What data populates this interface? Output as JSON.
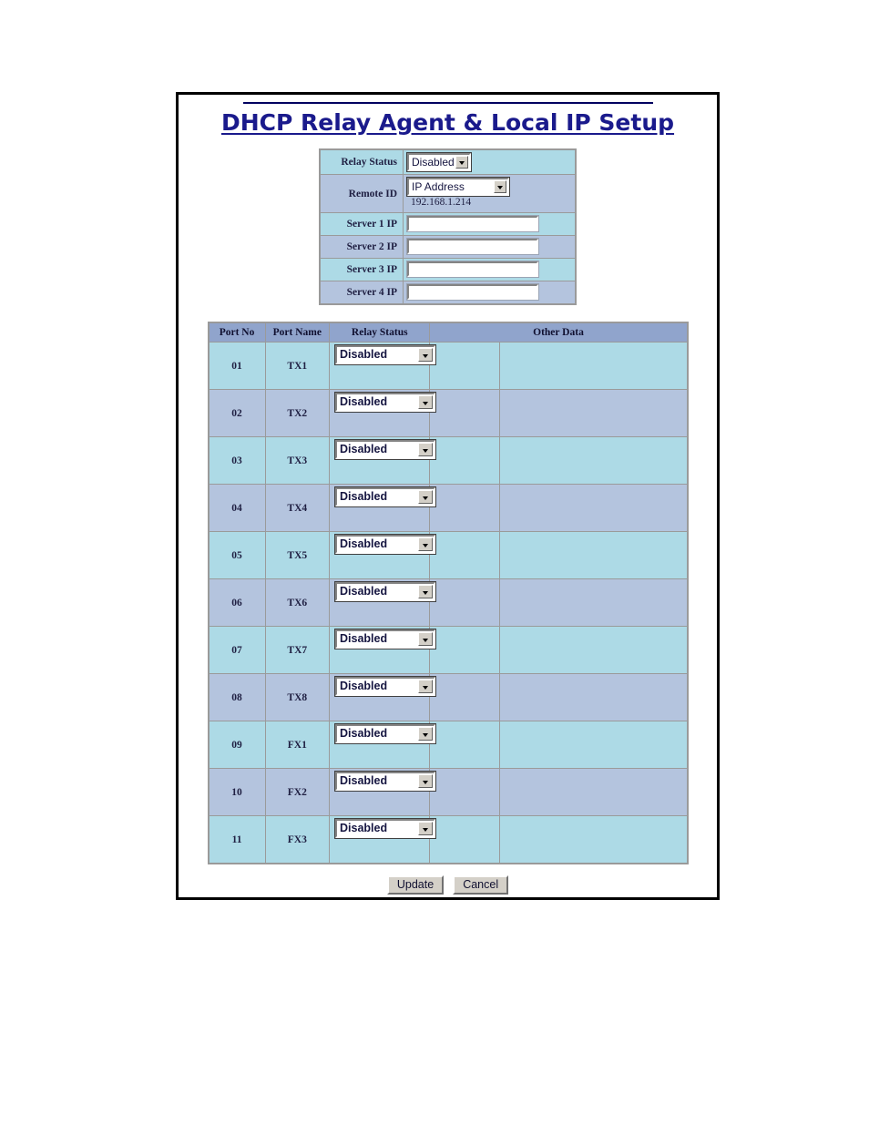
{
  "page": {
    "title": "DHCP Relay Agent & Local IP Setup"
  },
  "settings": {
    "rows": [
      {
        "label": "Relay Status",
        "control": "select",
        "value": "Disabled"
      },
      {
        "label": "Remote ID",
        "control": "select",
        "value": "IP Address",
        "note": "192.168.1.214"
      },
      {
        "label": "Server 1 IP",
        "control": "text",
        "value": ""
      },
      {
        "label": "Server 2 IP",
        "control": "text",
        "value": ""
      },
      {
        "label": "Server 3 IP",
        "control": "text",
        "value": ""
      },
      {
        "label": "Server 4 IP",
        "control": "text",
        "value": ""
      }
    ]
  },
  "ports_table": {
    "headers": [
      "Port No",
      "Port Name",
      "Relay Status",
      "Other Data"
    ],
    "rows": [
      {
        "no": "01",
        "name": "TX1",
        "relay_status": "Disabled",
        "other_1": "",
        "other_2": ""
      },
      {
        "no": "02",
        "name": "TX2",
        "relay_status": "Disabled",
        "other_1": "",
        "other_2": ""
      },
      {
        "no": "03",
        "name": "TX3",
        "relay_status": "Disabled",
        "other_1": "",
        "other_2": ""
      },
      {
        "no": "04",
        "name": "TX4",
        "relay_status": "Disabled",
        "other_1": "",
        "other_2": ""
      },
      {
        "no": "05",
        "name": "TX5",
        "relay_status": "Disabled",
        "other_1": "",
        "other_2": ""
      },
      {
        "no": "06",
        "name": "TX6",
        "relay_status": "Disabled",
        "other_1": "",
        "other_2": ""
      },
      {
        "no": "07",
        "name": "TX7",
        "relay_status": "Disabled",
        "other_1": "",
        "other_2": ""
      },
      {
        "no": "08",
        "name": "TX8",
        "relay_status": "Disabled",
        "other_1": "",
        "other_2": ""
      },
      {
        "no": "09",
        "name": "FX1",
        "relay_status": "Disabled",
        "other_1": "",
        "other_2": ""
      },
      {
        "no": "10",
        "name": "FX2",
        "relay_status": "Disabled",
        "other_1": "",
        "other_2": ""
      },
      {
        "no": "11",
        "name": "FX3",
        "relay_status": "Disabled",
        "other_1": "",
        "other_2": ""
      }
    ]
  },
  "footer": {
    "update_label": "Update",
    "cancel_label": "Cancel"
  },
  "colors": {
    "title": "#1a1a8c",
    "header_bar": "#90a4cc",
    "row_cyan": "#addae6",
    "row_blue": "#b4c4de",
    "grid_line": "#9a9a9a"
  }
}
